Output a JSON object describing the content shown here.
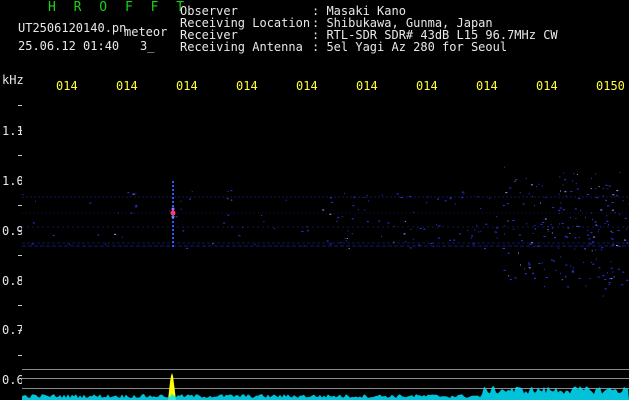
{
  "header": {
    "station": "H R O F F T",
    "filename": "UT2506120140.pn",
    "type": "meteor",
    "datetime": "25.06.12 01:40",
    "count": "3_"
  },
  "info": {
    "labels": [
      "Observer",
      "Receiving Location",
      "Receiver",
      "Receiving Antenna"
    ],
    "values": [
      ": Masaki Kano",
      ": Shibukawa, Gunma, Japan",
      ": RTL-SDR SDR# 43dB L15 96.7MHz CW",
      ": 5el Yagi Az 280 for Seoul"
    ]
  },
  "axis": {
    "unit": "kHz",
    "time_ticks": [
      "014",
      "014",
      "014",
      "014",
      "014",
      "014",
      "014",
      "014",
      "014",
      "0150"
    ],
    "freq_ticks": [
      "1.1",
      "1.0",
      "0.9",
      "0.8",
      "0.7",
      "0.6"
    ]
  },
  "colors": {
    "header_title": "#19d219",
    "labels": "#ffff33",
    "signal": "#2a3aff",
    "echo_peak": "#ff3a6a",
    "noise_floor": "#00e5ff",
    "spike": "#ffff00"
  }
}
